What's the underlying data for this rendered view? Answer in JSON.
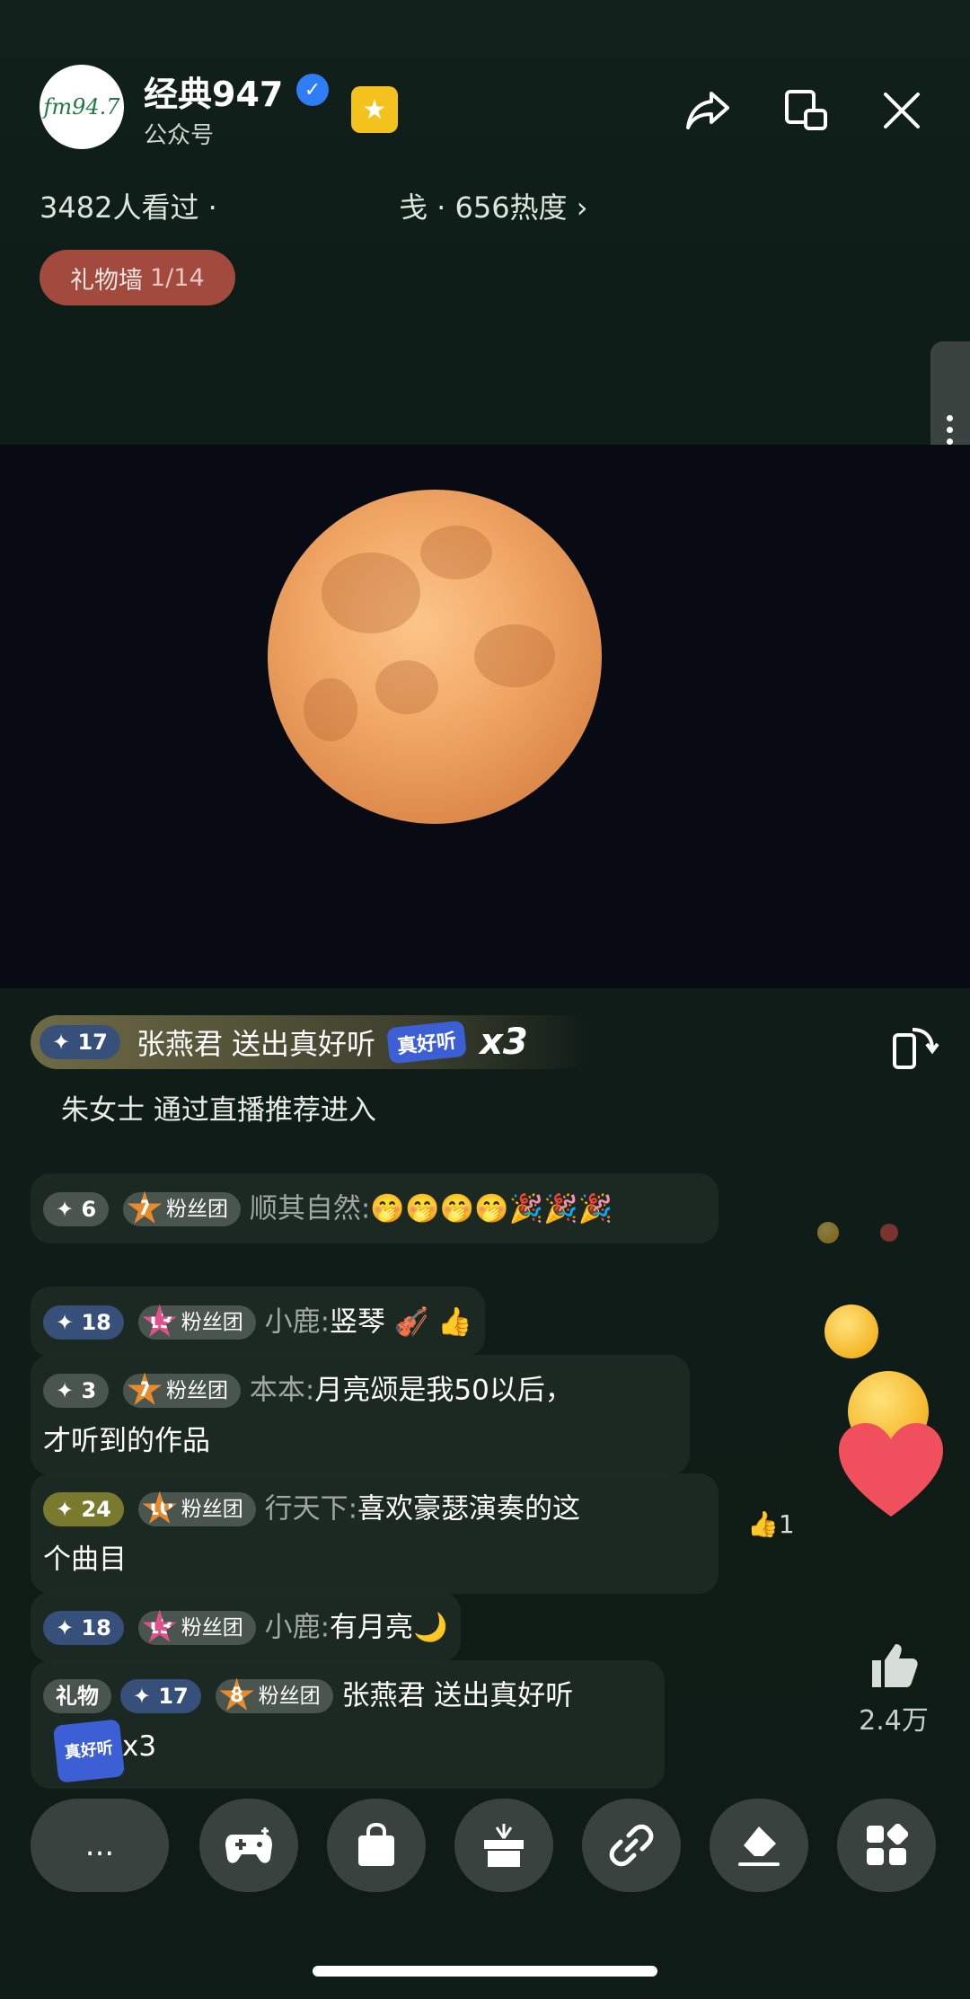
{
  "header": {
    "logo_text": "fm94.7",
    "title": "经典947",
    "subtitle": "公众号",
    "stats": "3482人看过 · 　　　　　　戋 · 656热度 ›",
    "gift_wall_label": "礼物墙",
    "gift_wall_count": "1/14"
  },
  "gift_banner": {
    "level": "17",
    "text": "张燕君 送出真好听",
    "gift_name": "真好听",
    "multiplier": "x3"
  },
  "enter_notice": "朱女士 通过直播推荐进入",
  "chat": [
    {
      "level": "6",
      "fan_level": "7",
      "fan_label": "粉丝团",
      "user": "顺其自然:",
      "content": "🤭🤭🤭🤭🎉🎉🎉"
    },
    {
      "level": "18",
      "fan_level": "13",
      "fan_label": "粉丝团",
      "user": "小鹿:",
      "content": "竖琴 🎻 👍"
    },
    {
      "level": "3",
      "fan_level": "7",
      "fan_label": "粉丝团",
      "user": "本本:",
      "content": "月亮颂是我50以后，",
      "content2": "才听到的作品"
    },
    {
      "level": "24",
      "fan_level": "10",
      "fan_label": "粉丝团",
      "user": "行天下:",
      "content": "喜欢豪瑟演奏的这",
      "content2": "个曲目"
    },
    {
      "level": "18",
      "fan_level": "13",
      "fan_label": "粉丝团",
      "user": "小鹿:",
      "content": "有月亮🌙"
    },
    {
      "tag": "礼物",
      "level": "17",
      "fan_level": "8",
      "fan_label": "粉丝团",
      "content": "张燕君 送出真好听",
      "gift_name": "真好听",
      "multiplier": "x3"
    }
  ],
  "likes": {
    "small_count": "1",
    "total": "2.4万"
  },
  "bottom_bar": {
    "input_label": "..."
  }
}
